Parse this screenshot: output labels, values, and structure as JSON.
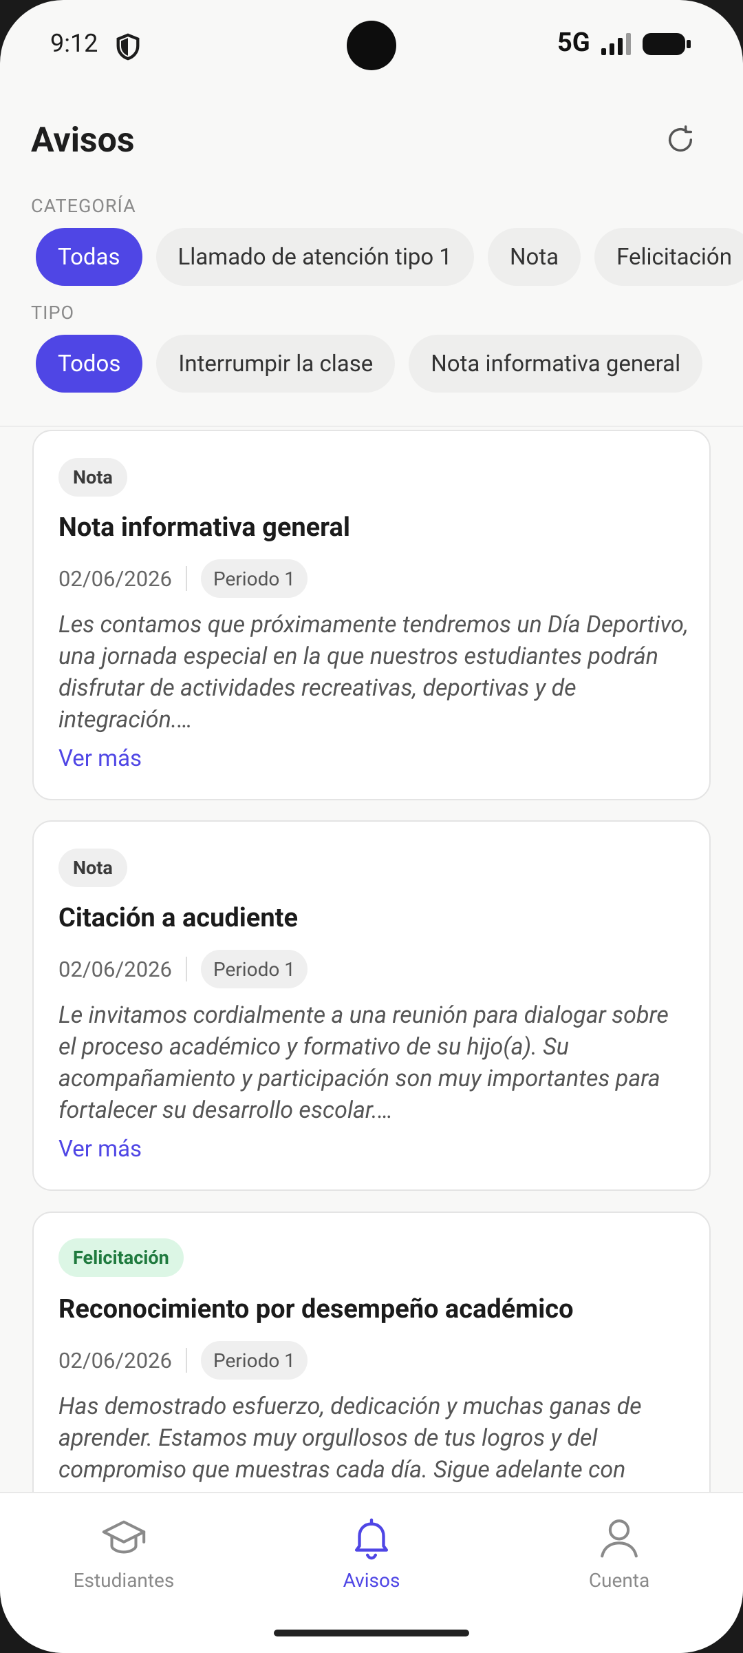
{
  "status": {
    "time": "9:12",
    "network": "5G"
  },
  "header": {
    "title": "Avisos"
  },
  "filters": {
    "category_label": "CATEGORÍA",
    "categories": [
      "Todas",
      "Llamado de atención tipo 1",
      "Nota",
      "Felicitación"
    ],
    "type_label": "TIPO",
    "types": [
      "Todos",
      "Interrumpir la clase",
      "Nota informativa general"
    ]
  },
  "notices": [
    {
      "badge": "Nota",
      "title": "Nota informativa general",
      "date": "02/06/2026",
      "period": "Periodo 1",
      "excerpt": "Les contamos que próximamente tendremos un Día Deportivo, una jornada especial en la que nuestros estudiantes podrán disfrutar de actividades recreativas, deportivas y de integración.…",
      "more": "Ver más"
    },
    {
      "badge": "Nota",
      "title": "Citación a acudiente",
      "date": "02/06/2026",
      "period": "Periodo 1",
      "excerpt": "Le invitamos cordialmente a una reunión para dialogar sobre el proceso académico y formativo de su hijo(a). Su acompañamiento y participación son muy importantes para fortalecer su desarrollo escolar.…",
      "more": "Ver más"
    },
    {
      "badge": "Felicitación",
      "title": "Reconocimiento por desempeño académico",
      "date": "02/06/2026",
      "period": "Periodo 1",
      "excerpt": "Has demostrado esfuerzo, dedicación y muchas ganas de aprender. Estamos muy orgullosos de tus logros y del compromiso que muestras cada día. Sigue adelante con"
    }
  ],
  "nav": {
    "items": [
      {
        "label": "Estudiantes",
        "icon": "graduation-cap-icon"
      },
      {
        "label": "Avisos",
        "icon": "bell-icon"
      },
      {
        "label": "Cuenta",
        "icon": "user-icon"
      }
    ],
    "active_color": "#4f46e5"
  }
}
